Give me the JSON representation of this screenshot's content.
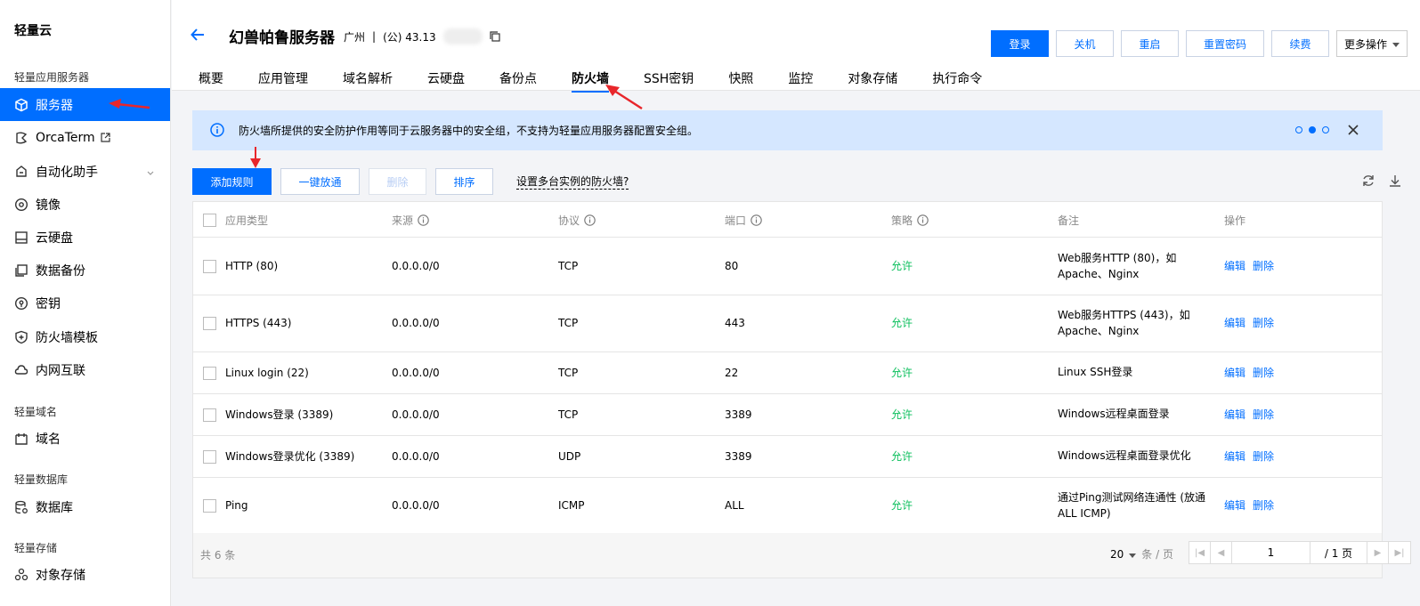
{
  "sidebar": {
    "brand": "轻量云",
    "sections": [
      {
        "title": "轻量应用服务器"
      },
      {
        "title": "轻量域名"
      },
      {
        "title": "轻量数据库"
      },
      {
        "title": "轻量存储"
      }
    ],
    "items": [
      {
        "label": "服务器",
        "icon": "cube-icon",
        "active": true
      },
      {
        "label": "OrcaTerm",
        "icon": "terminal-icon"
      },
      {
        "label": "自动化助手",
        "icon": "robot-icon"
      },
      {
        "label": "镜像",
        "icon": "disc-icon"
      },
      {
        "label": "云硬盘",
        "icon": "disk-icon"
      },
      {
        "label": "数据备份",
        "icon": "backup-icon"
      },
      {
        "label": "密钥",
        "icon": "key-icon"
      },
      {
        "label": "防火墙模板",
        "icon": "shield-icon"
      },
      {
        "label": "内网互联",
        "icon": "network-icon"
      },
      {
        "label": "域名",
        "icon": "domain-icon"
      },
      {
        "label": "数据库",
        "icon": "database-icon"
      },
      {
        "label": "对象存储",
        "icon": "storage-icon"
      }
    ]
  },
  "header": {
    "title": "幻兽帕鲁服务器",
    "region": "广州",
    "separator": "|",
    "ip_prefix": "(公) 43.13",
    "actions": [
      "登录",
      "关机",
      "重启",
      "重置密码",
      "续费",
      "更多操作"
    ]
  },
  "tabs": [
    "概要",
    "应用管理",
    "域名解析",
    "云硬盘",
    "备份点",
    "防火墙",
    "SSH密钥",
    "快照",
    "监控",
    "对象存储",
    "执行命令"
  ],
  "active_tab": "防火墙",
  "banner": {
    "text": "防火墙所提供的安全防护作用等同于云服务器中的安全组，不支持为轻量应用服务器配置安全组。"
  },
  "toolbar": {
    "add": "添加规则",
    "allow_all": "一键放通",
    "delete": "删除",
    "sort": "排序",
    "help": "设置多台实例的防火墙?"
  },
  "table": {
    "headers": [
      "应用类型",
      "来源",
      "协议",
      "端口",
      "策略",
      "备注",
      "操作"
    ],
    "rows": [
      {
        "type": "HTTP (80)",
        "source": "0.0.0.0/0",
        "protocol": "TCP",
        "port": "80",
        "policy": "允许",
        "note1": "Web服务HTTP (80)，如",
        "note2": "Apache、Nginx"
      },
      {
        "type": "HTTPS (443)",
        "source": "0.0.0.0/0",
        "protocol": "TCP",
        "port": "443",
        "policy": "允许",
        "note1": "Web服务HTTPS (443)，如",
        "note2": "Apache、Nginx"
      },
      {
        "type": "Linux login (22)",
        "source": "0.0.0.0/0",
        "protocol": "TCP",
        "port": "22",
        "policy": "允许",
        "note1": "Linux SSH登录",
        "note2": ""
      },
      {
        "type": "Windows登录 (3389)",
        "source": "0.0.0.0/0",
        "protocol": "TCP",
        "port": "3389",
        "policy": "允许",
        "note1": "Windows远程桌面登录",
        "note2": ""
      },
      {
        "type": "Windows登录优化 (3389)",
        "source": "0.0.0.0/0",
        "protocol": "UDP",
        "port": "3389",
        "policy": "允许",
        "note1": "Windows远程桌面登录优化",
        "note2": ""
      },
      {
        "type": "Ping",
        "source": "0.0.0.0/0",
        "protocol": "ICMP",
        "port": "ALL",
        "policy": "允许",
        "note1": "通过Ping测试网络连通性 (放通",
        "note2": "ALL ICMP)"
      }
    ],
    "edit": "编辑",
    "del": "删除"
  },
  "footer": {
    "total": "共 6 条",
    "page_size": "20",
    "page_size_unit": "条 / 页",
    "page_input": "1",
    "page_total": "/ 1 页"
  },
  "colors": {
    "primary": "#006eff",
    "allow": "#0abf5b",
    "banner": "#d5e7ff"
  }
}
